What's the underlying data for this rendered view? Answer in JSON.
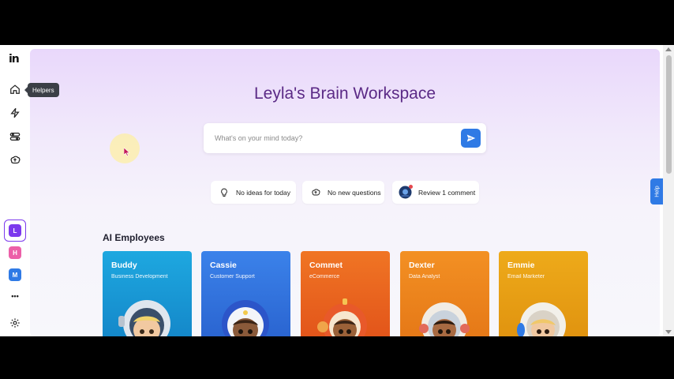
{
  "sidebar": {
    "logo": "in",
    "tooltip": "Helpers",
    "workspaces": [
      {
        "letter": "L",
        "color": "#7c3aed"
      },
      {
        "letter": "H",
        "color": "#ec5fa8"
      },
      {
        "letter": "M",
        "color": "#2f7ae5"
      }
    ],
    "more_label": "•••"
  },
  "main": {
    "title": "Leyla's Brain Workspace",
    "search": {
      "placeholder": "What's on your mind today?"
    },
    "chips": [
      {
        "label": "No ideas for today",
        "icon": "lightbulb-icon"
      },
      {
        "label": "No new questions",
        "icon": "brain-icon"
      },
      {
        "label": "Review 1 comment",
        "icon": "avatar-icon"
      }
    ],
    "section_title": "AI Employees",
    "employees": [
      {
        "name": "Buddy",
        "role": "Business Development",
        "color": "#1e9bdb"
      },
      {
        "name": "Cassie",
        "role": "Customer Support",
        "color": "#3579e6"
      },
      {
        "name": "Commet",
        "role": "eCommerce",
        "color": "#ef6b1f"
      },
      {
        "name": "Dexter",
        "role": "Data Analyst",
        "color": "#ef8a1a"
      },
      {
        "name": "Emmie",
        "role": "Email Marketer",
        "color": "#eaa818"
      }
    ]
  },
  "help_label": "Help"
}
